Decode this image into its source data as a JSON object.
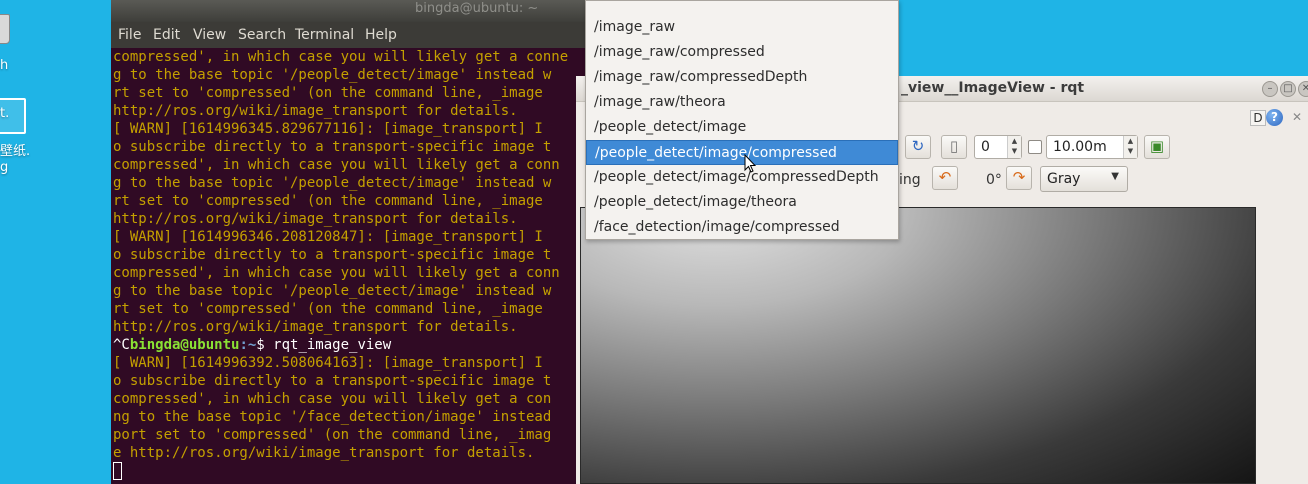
{
  "desktop": {
    "icon1_label": "h",
    "icon2_label_a": "t.",
    "icon2_label_b": "壁纸.",
    "icon2_label_c": "g"
  },
  "terminal": {
    "title": "bingda@ubuntu: ~",
    "menu": [
      "File",
      "Edit",
      "View",
      "Search",
      "Terminal",
      "Help"
    ],
    "lines": [
      "compressed', in which case you will likely get a conne",
      "g to the base topic '/people_detect/image' instead w",
      "rt set to 'compressed' (on the command line, _image",
      "http://ros.org/wiki/image_transport for details.",
      "[ WARN] [1614996345.829677116]: [image_transport] I",
      "o subscribe directly to a transport-specific image t",
      "compressed', in which case you will likely get a conn",
      "g to the base topic '/people_detect/image' instead w",
      "rt set to 'compressed' (on the command line, _image",
      "http://ros.org/wiki/image_transport for details.",
      "[ WARN] [1614996346.208120847]: [image_transport] I",
      "o subscribe directly to a transport-specific image t",
      "compressed', in which case you will likely get a conn",
      "g to the base topic '/people_detect/image' instead w",
      "rt set to 'compressed' (on the command line, _image",
      "http://ros.org/wiki/image_transport for details."
    ],
    "prompt": {
      "prefix": "^C",
      "user": "bingda@ubuntu",
      "path": ":~",
      "symbol": "$ ",
      "command": "rqt_image_view"
    },
    "lines_after": [
      "[ WARN] [1614996392.508064163]: [image_transport] I",
      "o subscribe directly to a transport-specific image t",
      "compressed', in which case you will likely get a con",
      "ng to the base topic '/face_detection/image' instead",
      "port set to 'compressed' (on the command line, _imag",
      "e http://ros.org/wiki/image_transport for details."
    ]
  },
  "rqt": {
    "title": "_view__ImageView - rqt",
    "help_d": "D",
    "help_q": "?",
    "close": "✕",
    "min_btn": "–",
    "max_btn": "□",
    "close_btn": "✕",
    "refresh_icon": "↻",
    "topic_icon": "▯",
    "spin_value": "0",
    "timeout_value": "10.00m",
    "save_icon": "▣",
    "smoothing_label": "ing",
    "rotate_left_icon": "↶",
    "rotation_label": "0°",
    "rotate_right_icon": "↷",
    "color_scheme": "Gray"
  },
  "dropdown": {
    "items": [
      "/image_raw",
      "/image_raw/compressed",
      "/image_raw/compressedDepth",
      "/image_raw/theora",
      "/people_detect/image",
      "/people_detect/image/compressed",
      "/people_detect/image/compressedDepth",
      "/people_detect/image/theora",
      "/face_detection/image/compressed"
    ],
    "selected_index": 5
  },
  "colors": {
    "desktop_bg": "#1fb4e6",
    "terminal_bg": "#300a24",
    "terminal_text": "#c4a000",
    "selection": "#3f8ad6"
  }
}
